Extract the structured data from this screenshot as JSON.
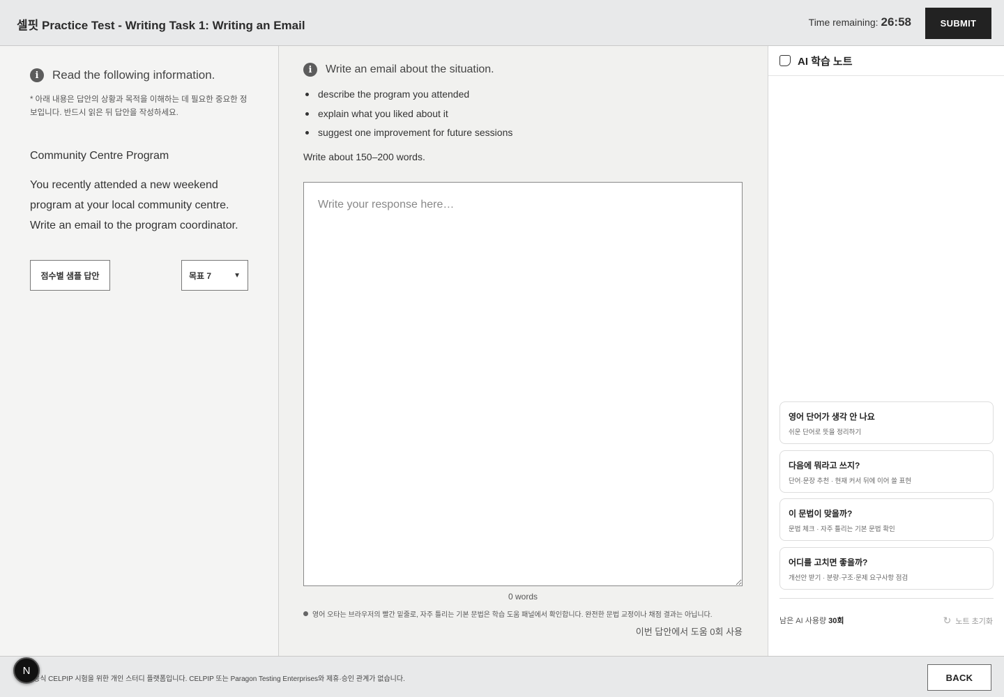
{
  "header": {
    "title": "셀핏 Practice Test - Writing Task 1: Writing an Email",
    "timer_label": "Time remaining:",
    "timer_value": "26:58",
    "submit_label": "SUBMIT"
  },
  "left": {
    "info_icon": "info-icon",
    "info_text": "Read the following information.",
    "note": "* 아래 내용은 답안의 상황과 목적을 이해하는 데 필요한 중요한 정보입니다. 반드시 읽은 뒤 답안을 작성하세요.",
    "program_title": "Community Centre Program",
    "program_desc": "You recently attended a new weekend program at your local community centre. Write an email to the program coordinator.",
    "sample_button": "점수별 샘플 답안",
    "goal_select": "목표 7"
  },
  "middle": {
    "info_text": "Write an email about the situation.",
    "bullets": [
      "describe the program you attended",
      "explain what you liked about it",
      "suggest one improvement for future sessions"
    ],
    "word_limit": "Write about 150–200 words.",
    "response_placeholder": "Write your response here…",
    "word_count": "0 words",
    "spell_note": "영어 오타는 브라우저의 빨간 밑줄로, 자주 틀리는 기본 문법은 학습 도움 패널에서 확인합니다. 완전한 문법 교정이나 채점 결과는 아닙니다.",
    "help_count": "이번 답안에서 도움 0회 사용"
  },
  "right": {
    "header_label": "AI 학습 노트",
    "cards": [
      {
        "title": "영어 단어가 생각 안 나요",
        "sub": "쉬운 단어로 뜻을 정리하기"
      },
      {
        "title": "다음에 뭐라고 쓰지?",
        "sub": "단어·문장 추천 · 현재 커서 뒤에 이어 쓸 표현"
      },
      {
        "title": "이 문법이 맞을까?",
        "sub": "문법 체크 · 자주 틀리는 기본 문법 확인"
      },
      {
        "title": "어디를 고치면 좋을까?",
        "sub": "개선안 받기 · 분량·구조·문제 요구사항 점검"
      }
    ],
    "usage_label": "남은 AI 사용량",
    "usage_value": "30회",
    "reset_label": "노트 초기화"
  },
  "footer": {
    "disclaimer": "공식 CELPIP 시험을 위한 개인 스터디 플랫폼입니다. CELPIP 또는 Paragon Testing Enterprises와 제휴·승인 관계가 없습니다.",
    "back_label": "BACK",
    "badge_letter": "N"
  }
}
